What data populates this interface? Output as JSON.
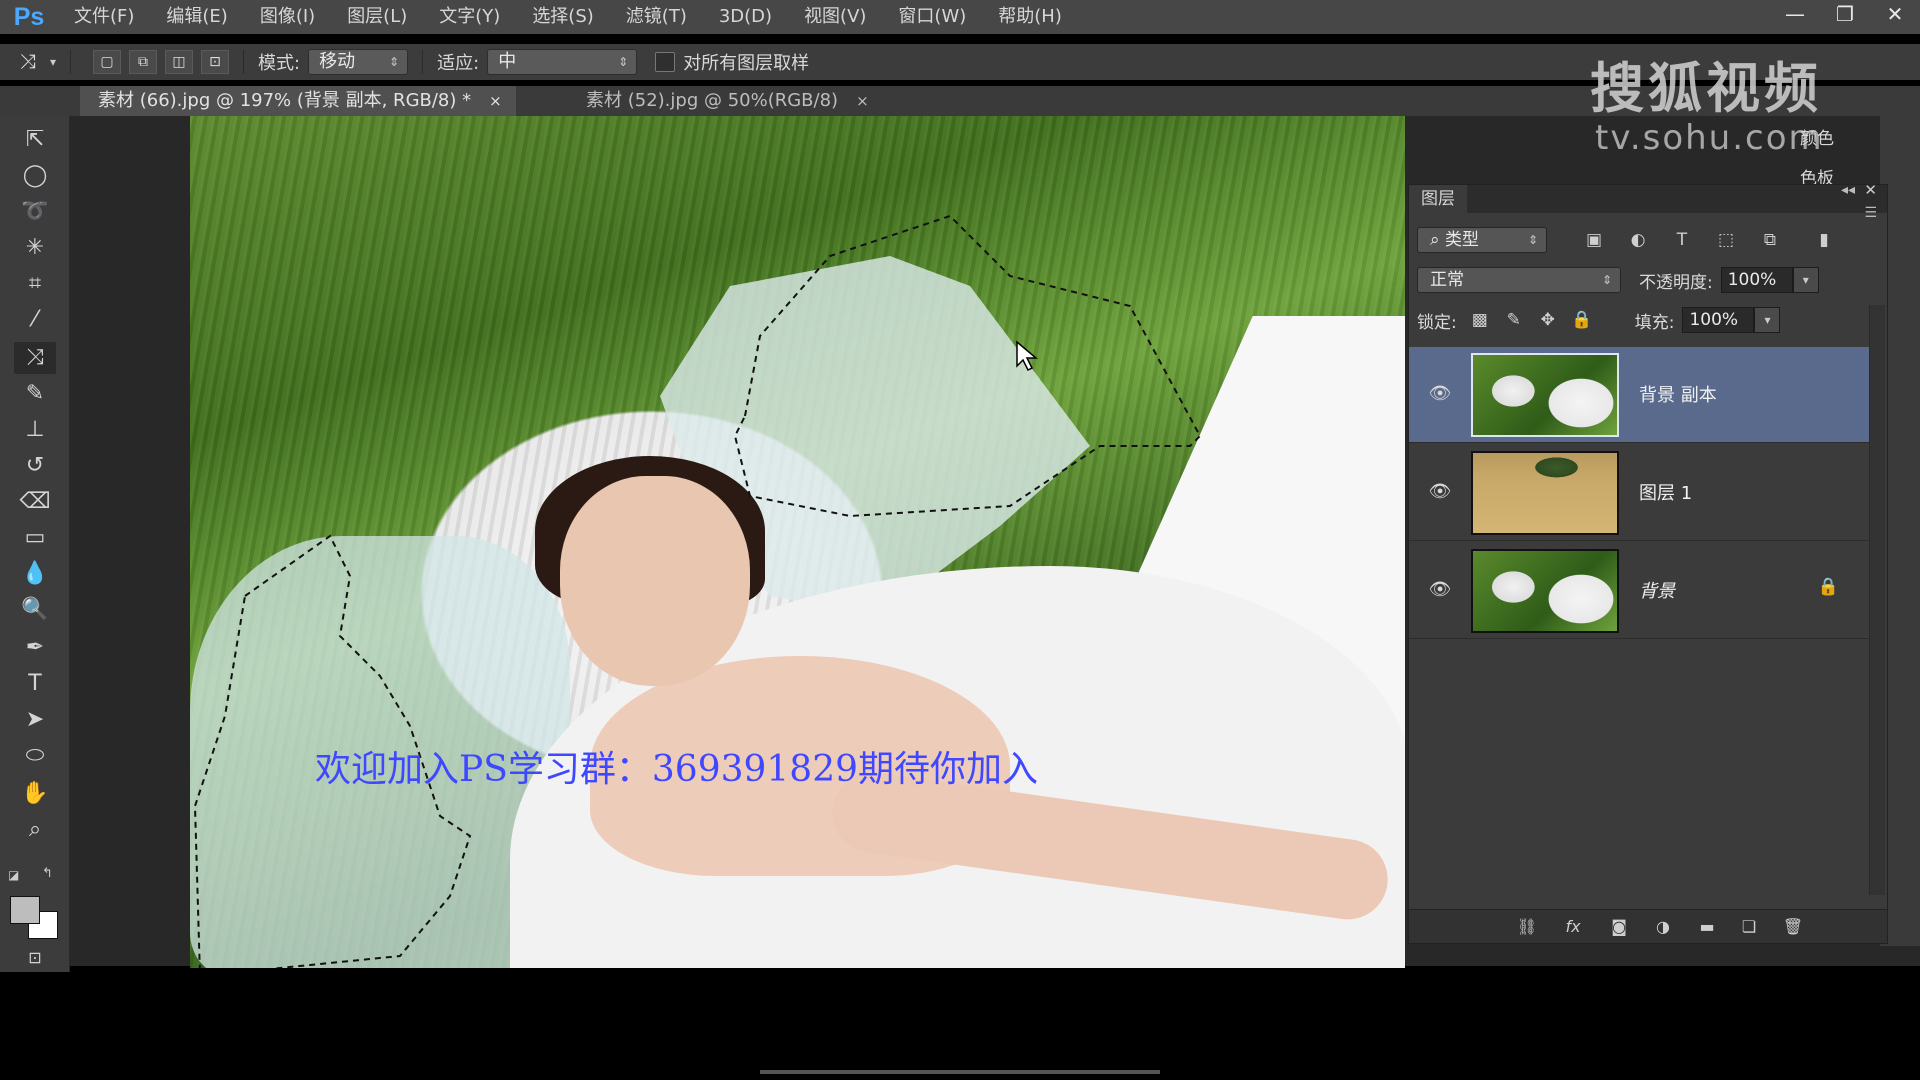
{
  "app": {
    "logo": "Ps"
  },
  "menu": [
    "文件(F)",
    "编辑(E)",
    "图像(I)",
    "图层(L)",
    "文字(Y)",
    "选择(S)",
    "滤镜(T)",
    "3D(D)",
    "视图(V)",
    "窗口(W)",
    "帮助(H)"
  ],
  "window_controls": {
    "minimize": "—",
    "restore": "❐",
    "close": "✕"
  },
  "options": {
    "mode_label": "模式:",
    "mode_value": "移动",
    "adapt_label": "适应:",
    "adapt_value": "中",
    "sample_all_label": "对所有图层取样"
  },
  "tabs": [
    {
      "label": "素材 (66).jpg @ 197% (背景 副本, RGB/8) *",
      "close": "×"
    },
    {
      "label": "素材 (52).jpg @ 50%(RGB/8)",
      "close": "×"
    }
  ],
  "canvas": {
    "overlay_text": "欢迎加入PS学习群：369391829期待你加入"
  },
  "watermark": {
    "logo": "搜狐视频",
    "url": "tv.sohu.com"
  },
  "dock": {
    "color_label": "颜色",
    "swatch_label": "色板"
  },
  "layers_panel": {
    "title": "图层",
    "filter_value": "类型",
    "blend_mode": "正常",
    "opacity_label": "不透明度:",
    "opacity_value": "100%",
    "lock_label": "锁定:",
    "fill_label": "填充:",
    "fill_value": "100%",
    "layers": [
      {
        "name": "背景 副本",
        "selected": true
      },
      {
        "name": "图层 1",
        "selected": false
      },
      {
        "name": "背景",
        "selected": false,
        "locked": true
      }
    ]
  },
  "colors": {
    "accent": "#4aa8ff",
    "selected_layer": "#5a6a8c",
    "overlay_text": "#3f48ff"
  }
}
